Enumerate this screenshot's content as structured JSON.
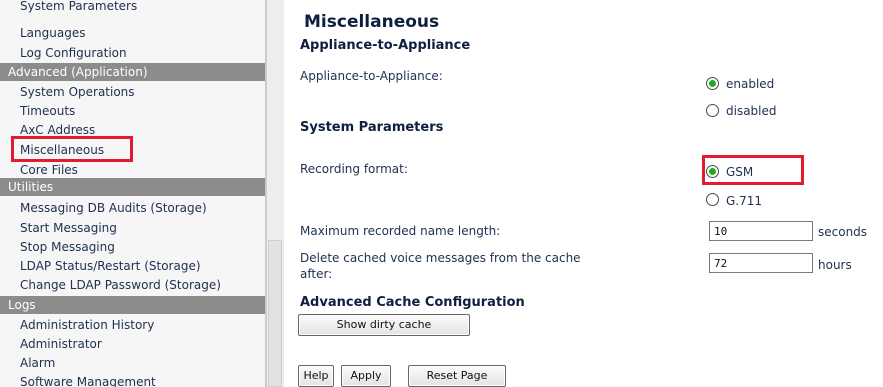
{
  "sidebar": {
    "items": [
      {
        "label": "System Parameters",
        "type": "item"
      },
      {
        "label": "Languages",
        "type": "item"
      },
      {
        "label": "Log Configuration",
        "type": "item"
      },
      {
        "label": "Advanced (Application)",
        "type": "header"
      },
      {
        "label": "System Operations",
        "type": "item"
      },
      {
        "label": "Timeouts",
        "type": "item"
      },
      {
        "label": "AxC Address",
        "type": "item"
      },
      {
        "label": "Miscellaneous",
        "type": "item",
        "highlighted": true
      },
      {
        "label": "Core Files",
        "type": "item"
      },
      {
        "label": "Utilities",
        "type": "header"
      },
      {
        "label": "Messaging DB Audits (Storage)",
        "type": "item"
      },
      {
        "label": "Start Messaging",
        "type": "item"
      },
      {
        "label": "Stop Messaging",
        "type": "item"
      },
      {
        "label": "LDAP Status/Restart (Storage)",
        "type": "item"
      },
      {
        "label": "Change LDAP Password (Storage)",
        "type": "item"
      },
      {
        "label": "Logs",
        "type": "header"
      },
      {
        "label": "Administration History",
        "type": "item"
      },
      {
        "label": "Administrator",
        "type": "item"
      },
      {
        "label": "Alarm",
        "type": "item"
      },
      {
        "label": "Software Management",
        "type": "item"
      }
    ]
  },
  "main": {
    "title": "Miscellaneous",
    "a2a": {
      "heading": "Appliance-to-Appliance",
      "label": "Appliance-to-Appliance:",
      "options": [
        {
          "label": "enabled",
          "checked": true
        },
        {
          "label": "disabled",
          "checked": false
        }
      ]
    },
    "system_parameters": {
      "heading": "System Parameters",
      "recording_format": {
        "label": "Recording format:",
        "options": [
          {
            "label": "GSM",
            "checked": true,
            "highlighted": true
          },
          {
            "label": "G.711",
            "checked": false
          }
        ]
      },
      "max_name_length": {
        "label": "Maximum recorded name length:",
        "value": "10",
        "unit": "seconds"
      },
      "delete_cached": {
        "label_line1": "Delete cached voice messages from the cache",
        "label_line2": "after:",
        "value": "72",
        "unit": "hours"
      }
    },
    "advanced_cache": {
      "heading": "Advanced Cache Configuration",
      "button": "Show dirty cache"
    },
    "footer_buttons": {
      "help": "Help",
      "apply": "Apply",
      "reset": "Reset Page"
    }
  },
  "colors": {
    "highlight_box": "#e41b2c",
    "sidebar_header_bg": "#8c8c8c",
    "radio_checked": "#1faa1f",
    "text": "#1f2f4f"
  }
}
